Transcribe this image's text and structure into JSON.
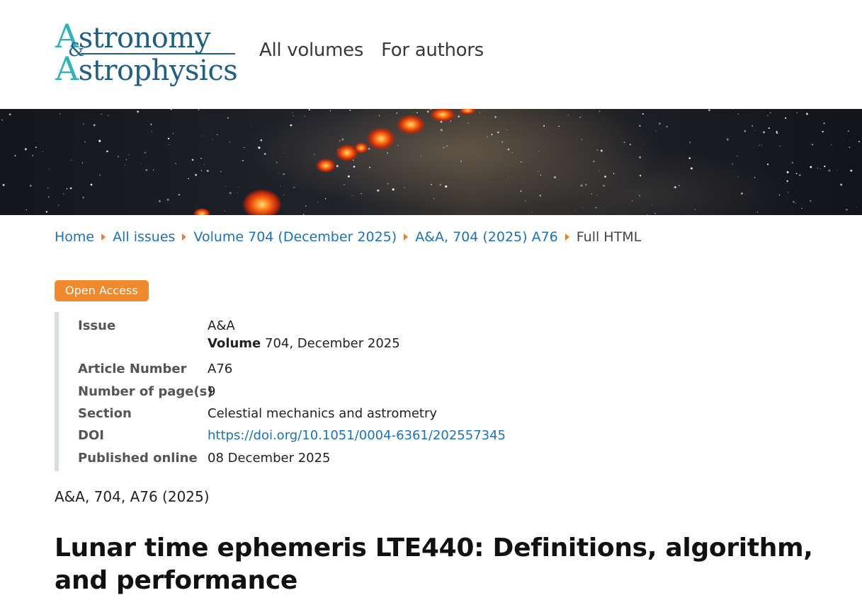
{
  "logo": {
    "line1_cap": "A",
    "line1_rest": "stronomy",
    "amp": "&",
    "line2_cap": "A",
    "line2_rest": "strophysics"
  },
  "nav": {
    "all_volumes": "All volumes",
    "for_authors": "For authors"
  },
  "breadcrumb": {
    "home": "Home",
    "all_issues": "All issues",
    "volume": "Volume 704 (December 2025)",
    "article": "A&A, 704 (2025) A76",
    "current": "Full HTML"
  },
  "badge": "Open Access",
  "info": {
    "issue_label": "Issue",
    "issue_journal": "A&A",
    "issue_volume_label": "Volume",
    "issue_volume_value": "704, December 2025",
    "article_number_label": "Article Number",
    "article_number": "A76",
    "pages_label": "Number of page(s)",
    "pages": "9",
    "section_label": "Section",
    "section": "Celestial mechanics and astrometry",
    "doi_label": "DOI",
    "doi": "https://doi.org/10.1051/0004-6361/202557345",
    "published_label": "Published online",
    "published": "08 December 2025"
  },
  "citation": "A&A, 704, A76 (2025)",
  "title": "Lunar time ephemeris LTE440: Definitions, algorithm, and performance",
  "colors": {
    "accent": "#f08a2c",
    "link": "#1a73ba",
    "logo_teal": "#2fb3b8",
    "logo_blue": "#1f5f86"
  }
}
